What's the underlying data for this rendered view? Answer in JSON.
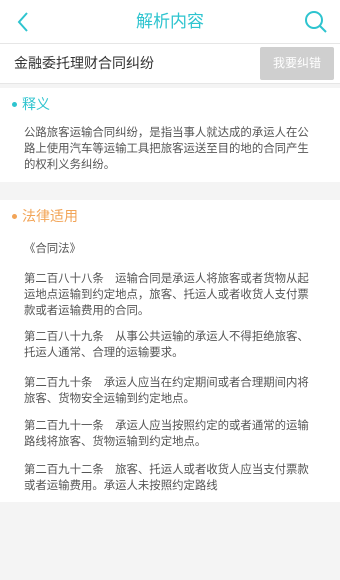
{
  "header": {
    "title": "解析内容"
  },
  "case": {
    "title": "金融委托理财合同纠纷",
    "correct_button": "我要纠错"
  },
  "definition": {
    "heading": "释义",
    "text": "公路旅客运输合同纠纷，是指当事人就达成的承运人在公路上使用汽车等运输工具把旅客运送至目的地的合同产生的权利义务纠纷。"
  },
  "law": {
    "heading": "法律适用",
    "paragraphs": [
      "《合同法》",
      "第二百八十八条　运输合同是承运人将旅客或者货物从起运地点运输到约定地点，旅客、托运人或者收货人支付票款或者运输费用的合同。",
      "第二百八十九条　从事公共运输的承运人不得拒绝旅客、托运人通常、合理的运输要求。",
      "第二百九十条　承运人应当在约定期间或者合理期间内将旅客、货物安全运输到约定地点。",
      "第二百九十一条　承运人应当按照约定的或者通常的运输路线将旅客、货物运输到约定地点。",
      "第二百九十二条　旅客、托运人或者收货人应当支付票款或者运输费用。承运人未按照约定路线"
    ]
  },
  "colors": {
    "accent": "#2ec4cf",
    "orange": "#f2a457",
    "button_gray": "#cfcfcf"
  }
}
